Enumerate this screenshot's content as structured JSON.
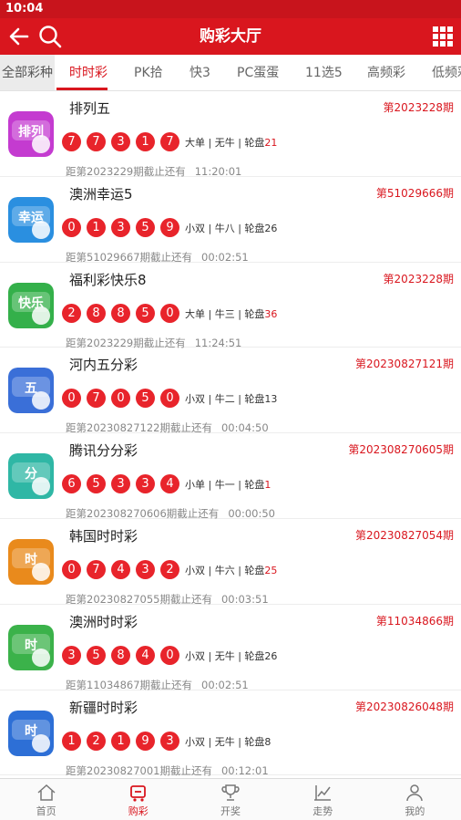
{
  "status": {
    "time": "10:04"
  },
  "header": {
    "title": "购彩大厅"
  },
  "tabs": [
    {
      "label": "全部彩种"
    },
    {
      "label": "时时彩"
    },
    {
      "label": "PK拾"
    },
    {
      "label": "快3"
    },
    {
      "label": "PC蛋蛋"
    },
    {
      "label": "11选5"
    },
    {
      "label": "高频彩"
    },
    {
      "label": "低频彩"
    }
  ],
  "lotteries": [
    {
      "name": "排列五",
      "period": "第2023228期",
      "balls": [
        "7",
        "7",
        "3",
        "1",
        "7"
      ],
      "attr_a": "大单 | 无牛 | 轮盘",
      "attr_b": "21",
      "attr_b_red": true,
      "next": "距第2023229期截止还有",
      "time": "11:20:01",
      "icon_text": "排列",
      "icon_color": "#c43bd0"
    },
    {
      "name": "澳洲幸运5",
      "period": "第51029666期",
      "balls": [
        "0",
        "1",
        "3",
        "5",
        "9"
      ],
      "attr_a": "小双 | 牛八 | 轮盘",
      "attr_b": "26",
      "attr_b_red": false,
      "next": "距第51029667期截止还有",
      "time": "00:02:51",
      "icon_text": "幸运",
      "icon_color": "#2a8fe0"
    },
    {
      "name": "福利彩快乐8",
      "period": "第2023228期",
      "balls": [
        "2",
        "8",
        "8",
        "5",
        "0"
      ],
      "attr_a": "大单 | 牛三 | 轮盘",
      "attr_b": "36",
      "attr_b_red": true,
      "next": "距第2023229期截止还有",
      "time": "11:24:51",
      "icon_text": "快乐",
      "icon_color": "#34b04a"
    },
    {
      "name": "河内五分彩",
      "period": "第20230827121期",
      "balls": [
        "0",
        "7",
        "0",
        "5",
        "0"
      ],
      "attr_a": "小双 | 牛二 | 轮盘",
      "attr_b": "13",
      "attr_b_red": false,
      "next": "距第20230827122期截止还有",
      "time": "00:04:50",
      "icon_text": "五",
      "icon_color": "#3a6fd8"
    },
    {
      "name": "腾讯分分彩",
      "period": "第20230827060​5期",
      "balls": [
        "6",
        "5",
        "3",
        "3",
        "4"
      ],
      "attr_a": "小单 | 牛一 | 轮盘",
      "attr_b": "1",
      "attr_b_red": true,
      "next": "距第20230827060​6期截止还有",
      "time": "00:00:50",
      "icon_text": "分",
      "icon_color": "#2fb7a5"
    },
    {
      "name": "韩国时时彩",
      "period": "第20230827054期",
      "balls": [
        "0",
        "7",
        "4",
        "3",
        "2"
      ],
      "attr_a": "小双 | 牛六 | 轮盘",
      "attr_b": "25",
      "attr_b_red": true,
      "next": "距第20230827055期截止还有",
      "time": "00:03:51",
      "icon_text": "时",
      "icon_color": "#e98a1c"
    },
    {
      "name": "澳洲时时彩",
      "period": "第11034866期",
      "balls": [
        "3",
        "5",
        "8",
        "4",
        "0"
      ],
      "attr_a": "小双 | 无牛 | 轮盘",
      "attr_b": "26",
      "attr_b_red": false,
      "next": "距第11034867期截止还有",
      "time": "00:02:51",
      "icon_text": "时",
      "icon_color": "#3bb24a"
    },
    {
      "name": "新疆时时彩",
      "period": "第20230826048期",
      "balls": [
        "1",
        "2",
        "1",
        "9",
        "3"
      ],
      "attr_a": "小双 | 无牛 | 轮盘",
      "attr_b": "8",
      "attr_b_red": false,
      "next": "距第20230827001期截止还有",
      "time": "00:12:01",
      "icon_text": "时",
      "icon_color": "#2d6fd6"
    }
  ],
  "bottom_nav": [
    {
      "label": "首页",
      "icon": "home-icon"
    },
    {
      "label": "购彩",
      "icon": "cart-icon"
    },
    {
      "label": "开奖",
      "icon": "trophy-icon"
    },
    {
      "label": "走势",
      "icon": "chart-icon"
    },
    {
      "label": "我的",
      "icon": "user-icon"
    }
  ],
  "colors": {
    "brand": "#d9161e",
    "ball": "#e8242b"
  }
}
